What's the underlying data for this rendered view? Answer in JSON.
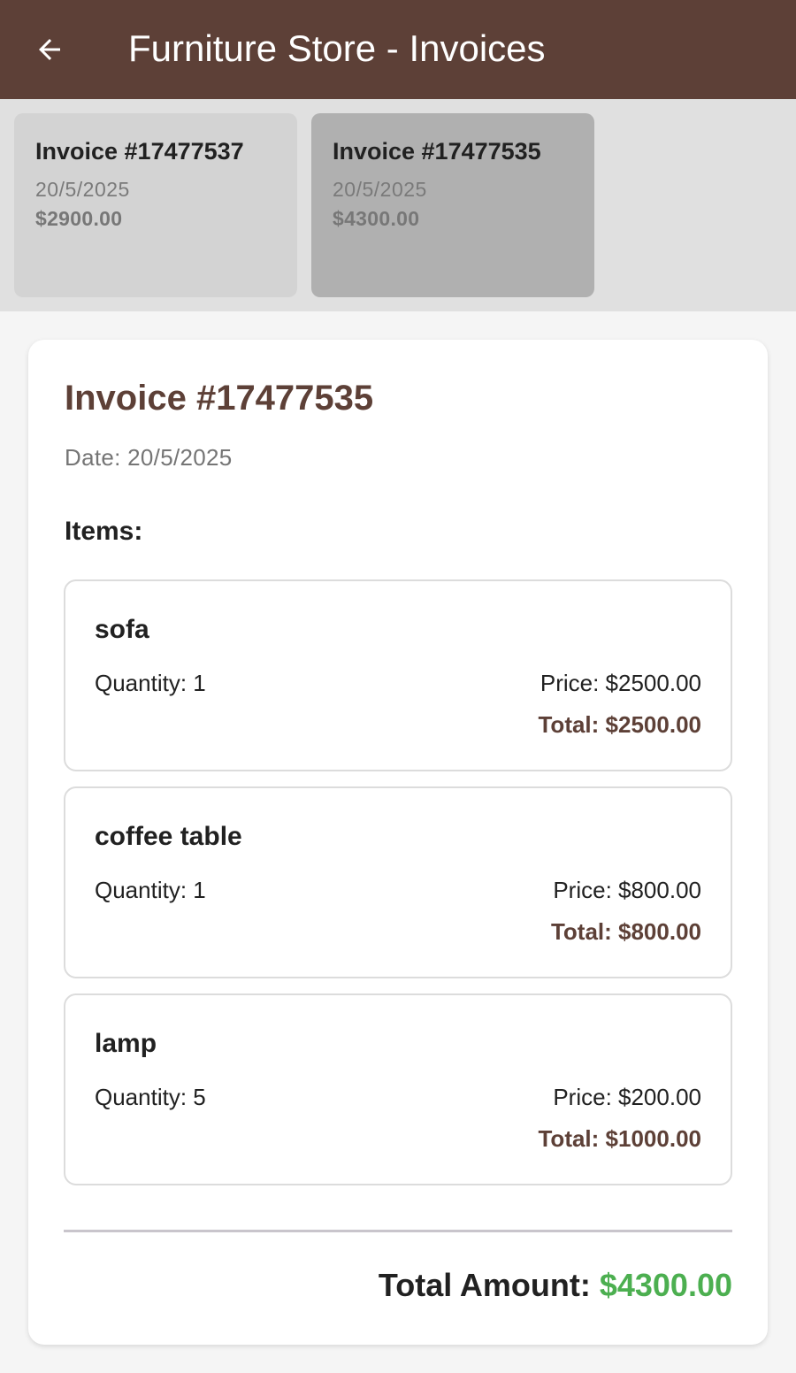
{
  "appbar": {
    "title": "Furniture Store - Invoices",
    "back_icon": "arrow-left-icon"
  },
  "invoice_list": [
    {
      "number": "Invoice #17477537",
      "date": "20/5/2025",
      "amount": "$2900.00",
      "selected": false
    },
    {
      "number": "Invoice #17477535",
      "date": "20/5/2025",
      "amount": "$4300.00",
      "selected": true
    }
  ],
  "detail": {
    "title": "Invoice #17477535",
    "date": "Date: 20/5/2025",
    "items_label": "Items:",
    "items": [
      {
        "name": "sofa",
        "quantity": "Quantity: 1",
        "price": "Price: $2500.00",
        "total": "Total: $2500.00"
      },
      {
        "name": "coffee table",
        "quantity": "Quantity: 1",
        "price": "Price: $800.00",
        "total": "Total: $800.00"
      },
      {
        "name": "lamp",
        "quantity": "Quantity: 5",
        "price": "Price: $200.00",
        "total": "Total: $1000.00"
      }
    ],
    "total_label": "Total Amount:",
    "total_value": "$4300.00"
  },
  "colors": {
    "appbar": "#5d4037",
    "accent_brown": "#5d4037",
    "total_green": "#4caf50",
    "strip_bg": "#e0e0e0",
    "selected_card": "#b0b0b0",
    "unselected_card": "#d3d3d3"
  }
}
